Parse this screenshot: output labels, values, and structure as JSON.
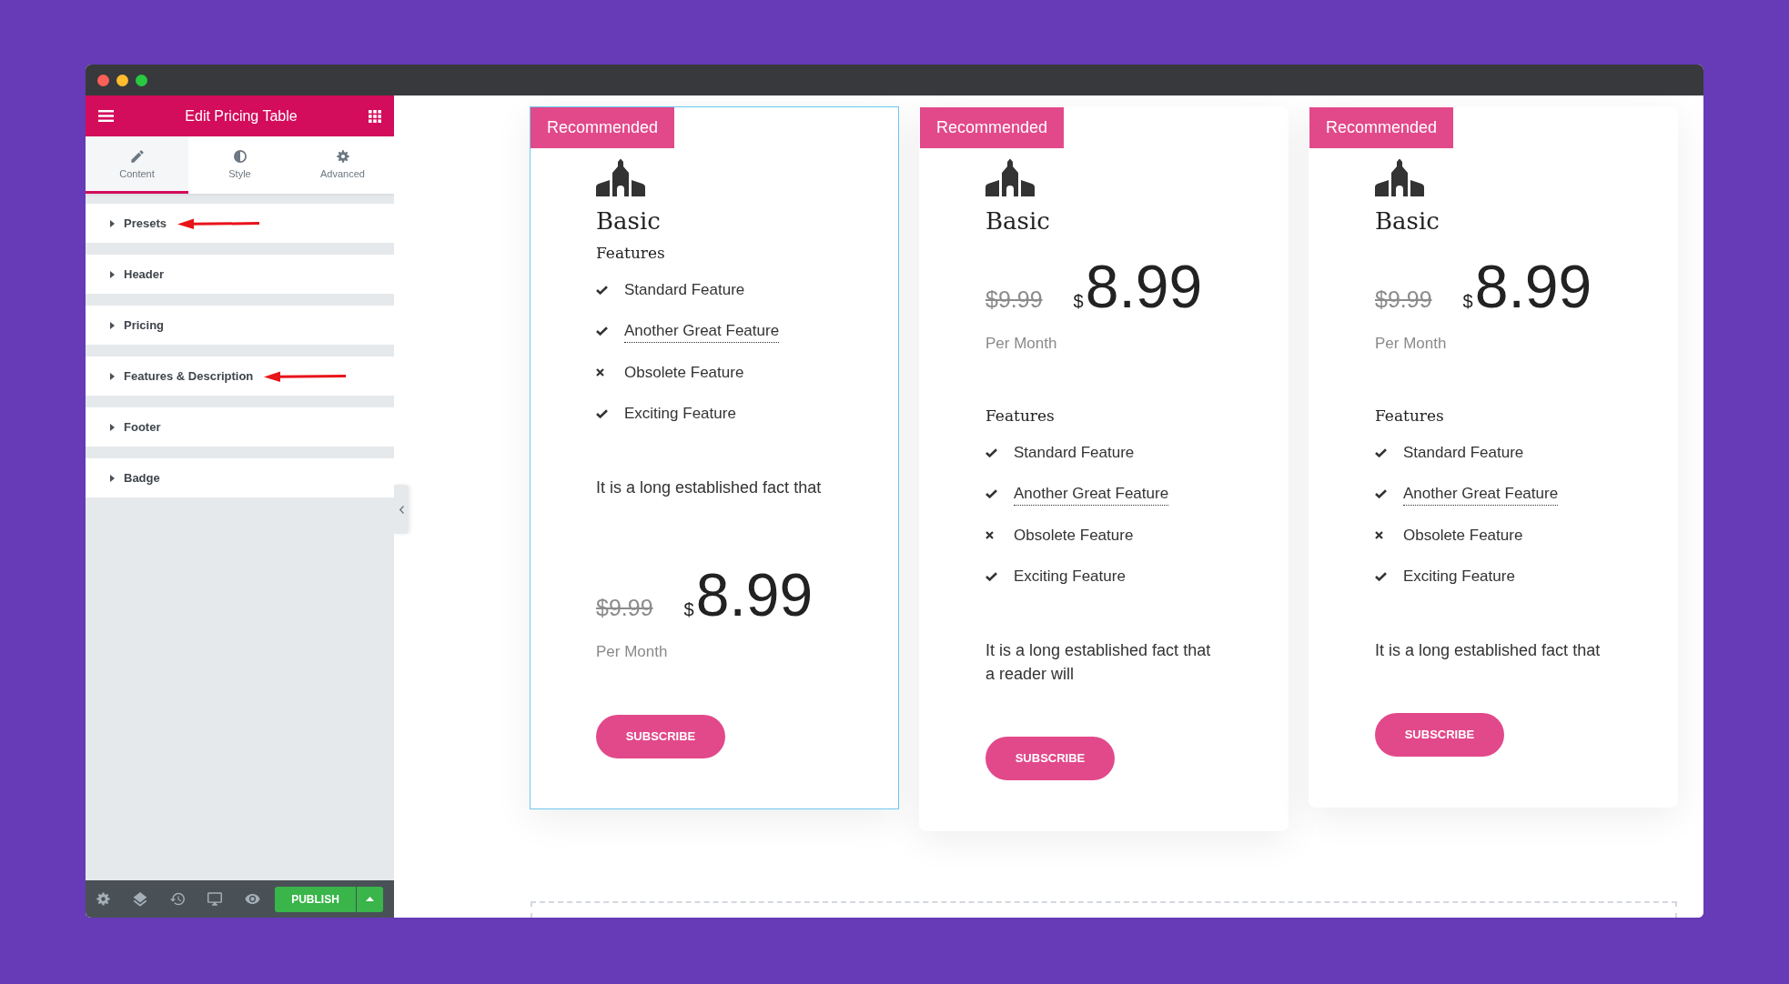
{
  "editor_panel": {
    "title": "Edit Pricing Table",
    "tabs": [
      {
        "label": "Content",
        "selected": true
      },
      {
        "label": "Style",
        "selected": false
      },
      {
        "label": "Advanced",
        "selected": false
      }
    ],
    "sections": [
      {
        "label": "Presets",
        "expanded": false,
        "annotation_arrow": true
      },
      {
        "label": "Header",
        "expanded": false,
        "annotation_arrow": false
      },
      {
        "label": "Pricing",
        "expanded": false,
        "annotation_arrow": false
      },
      {
        "label": "Features & Description",
        "expanded": false,
        "annotation_arrow": true
      },
      {
        "label": "Footer",
        "expanded": false,
        "annotation_arrow": false
      },
      {
        "label": "Badge",
        "expanded": false,
        "annotation_arrow": false
      }
    ],
    "publish_button": "PUBLISH"
  },
  "pricing_cards": [
    {
      "selected": true,
      "badge": "Recommended",
      "title": "Basic",
      "blocks": [
        {
          "kind": "features",
          "heading": "Features",
          "items": [
            {
              "text": "Standard Feature",
              "included": true,
              "has_tooltip": false
            },
            {
              "text": "Another Great Feature",
              "included": true,
              "has_tooltip": true
            },
            {
              "text": "Obsolete Feature",
              "included": false,
              "has_tooltip": false
            },
            {
              "text": "Exciting Feature",
              "included": true,
              "has_tooltip": false
            }
          ]
        },
        {
          "kind": "description",
          "text": "It is a long established fact that"
        },
        {
          "kind": "price",
          "old_price": "$9.99",
          "currency": "$",
          "amount": "8.99",
          "period": "Per Month"
        },
        {
          "kind": "button",
          "label": "SUBSCRIBE"
        }
      ]
    },
    {
      "selected": false,
      "badge": "Recommended",
      "title": "Basic",
      "blocks": [
        {
          "kind": "price",
          "old_price": "$9.99",
          "currency": "$",
          "amount": "8.99",
          "period": "Per Month"
        },
        {
          "kind": "features",
          "heading": "Features",
          "items": [
            {
              "text": "Standard Feature",
              "included": true,
              "has_tooltip": false
            },
            {
              "text": "Another Great Feature",
              "included": true,
              "has_tooltip": true
            },
            {
              "text": "Obsolete Feature",
              "included": false,
              "has_tooltip": false
            },
            {
              "text": "Exciting Feature",
              "included": true,
              "has_tooltip": false
            }
          ]
        },
        {
          "kind": "description",
          "text": "It is a long established fact that a reader will"
        },
        {
          "kind": "button",
          "label": "SUBSCRIBE"
        }
      ]
    },
    {
      "selected": false,
      "badge": "Recommended",
      "title": "Basic",
      "blocks": [
        {
          "kind": "price",
          "old_price": "$9.99",
          "currency": "$",
          "amount": "8.99",
          "period": "Per Month"
        },
        {
          "kind": "features",
          "heading": "Features",
          "items": [
            {
              "text": "Standard Feature",
              "included": true,
              "has_tooltip": false
            },
            {
              "text": "Another Great Feature",
              "included": true,
              "has_tooltip": true
            },
            {
              "text": "Obsolete Feature",
              "included": false,
              "has_tooltip": false
            },
            {
              "text": "Exciting Feature",
              "included": true,
              "has_tooltip": false
            }
          ]
        },
        {
          "kind": "description",
          "text": "It is a long established fact that"
        },
        {
          "kind": "button",
          "label": "SUBSCRIBE"
        }
      ]
    }
  ]
}
